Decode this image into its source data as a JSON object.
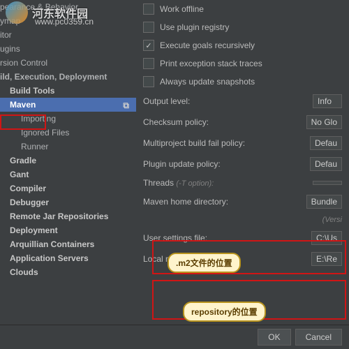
{
  "watermark": {
    "text": "河东软件园",
    "url": "www.pc0359.cn"
  },
  "sidebar": {
    "items": [
      {
        "label": "pearance & Behavior",
        "level": "lv0"
      },
      {
        "label": "ymap",
        "level": "lv0"
      },
      {
        "label": "itor",
        "level": "lv0"
      },
      {
        "label": "ugins",
        "level": "lv0"
      },
      {
        "label": "rsion Control",
        "level": "lv0"
      },
      {
        "label": "ild, Execution, Deployment",
        "level": "lv0",
        "bold": true
      },
      {
        "label": "Build Tools",
        "level": "lv1"
      },
      {
        "label": "Maven",
        "level": "lv1",
        "selected": true
      },
      {
        "label": "Importing",
        "level": "lv2"
      },
      {
        "label": "Ignored Files",
        "level": "lv2"
      },
      {
        "label": "Runner",
        "level": "lv2"
      },
      {
        "label": "Gradle",
        "level": "lv1"
      },
      {
        "label": "Gant",
        "level": "lv1"
      },
      {
        "label": "Compiler",
        "level": "lv1"
      },
      {
        "label": "Debugger",
        "level": "lv1"
      },
      {
        "label": "Remote Jar Repositories",
        "level": "lv1"
      },
      {
        "label": "Deployment",
        "level": "lv1"
      },
      {
        "label": "Arquillian Containers",
        "level": "lv1"
      },
      {
        "label": "Application Servers",
        "level": "lv1"
      },
      {
        "label": "Clouds",
        "level": "lv1"
      }
    ]
  },
  "checkboxes": {
    "offline": "Work offline",
    "registry": "Use plugin registry",
    "recursive": "Execute goals recursively",
    "traces": "Print exception stack traces",
    "snapshots": "Always update snapshots"
  },
  "fields": {
    "output_label": "Output level:",
    "output_value": "Info",
    "checksum_label": "Checksum policy:",
    "checksum_value": "No Glo",
    "fail_label": "Multiproject build fail policy:",
    "fail_value": "Defau",
    "plugin_label": "Plugin update policy:",
    "plugin_value": "Defau",
    "threads_label": "Threads",
    "threads_hint": "(-T option):",
    "home_label": "Maven home directory:",
    "home_value": "Bundle",
    "home_version": "(Versi",
    "settings_label": "User settings file:",
    "settings_value": "C:\\Us",
    "repo_label": "Local repository:",
    "repo_value": "E:\\Re"
  },
  "callouts": {
    "m2": ".m2文件的位置",
    "repo": "repository的位置"
  },
  "footer": {
    "ok": "OK",
    "cancel": "Cancel"
  }
}
